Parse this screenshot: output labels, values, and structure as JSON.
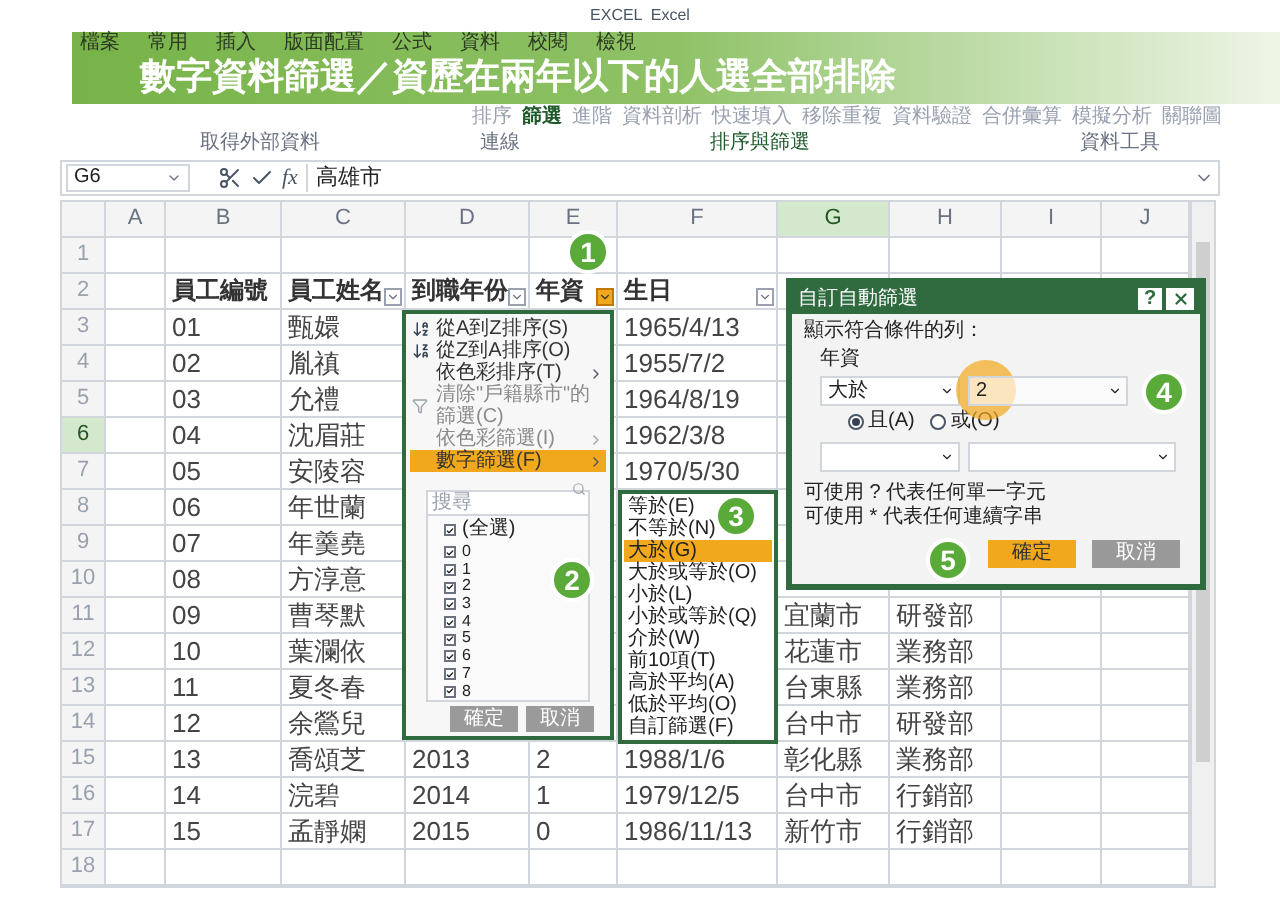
{
  "window": {
    "title": "EXCEL  Excel"
  },
  "banner": {
    "tabs": [
      "檔案",
      "常用",
      "插入",
      "版面配置",
      "公式",
      "資料",
      "校閱",
      "檢視"
    ],
    "title": "數字資料篩選／資歷在兩年以下的人選全部排除"
  },
  "ribbon": {
    "commands": [
      {
        "label": "排序",
        "selected": false
      },
      {
        "label": "篩選",
        "selected": true
      },
      {
        "label": "進階",
        "selected": false
      },
      {
        "label": "資料剖析",
        "selected": false
      },
      {
        "label": "快速填入",
        "selected": false
      },
      {
        "label": "移除重複",
        "selected": false
      },
      {
        "label": "資料驗證",
        "selected": false
      },
      {
        "label": "合併彙算",
        "selected": false
      },
      {
        "label": "模擬分析",
        "selected": false
      },
      {
        "label": "關聯圖",
        "selected": false
      }
    ],
    "groups": [
      "取得外部資料",
      "連線",
      "排序與篩選",
      "資料工具"
    ]
  },
  "formula_bar": {
    "name_box": "G6",
    "function_label": "fx",
    "formula": "高雄市"
  },
  "sheet": {
    "columns": [
      {
        "label": "A",
        "selected": false
      },
      {
        "label": "B",
        "selected": false
      },
      {
        "label": "C",
        "selected": false,
        "filter_button": {
          "active": false
        }
      },
      {
        "label": "D",
        "selected": false,
        "filter_button": {
          "active": false
        }
      },
      {
        "label": "E",
        "selected": false,
        "filter_button": {
          "active": true
        }
      },
      {
        "label": "F",
        "selected": false,
        "filter_button": {
          "active": false
        }
      },
      {
        "label": "G",
        "selected": true
      },
      {
        "label": "H",
        "selected": false
      },
      {
        "label": "I",
        "selected": false
      },
      {
        "label": "J",
        "selected": false
      }
    ],
    "rows": [
      {
        "number": "1",
        "selected": false,
        "cells": [
          null,
          null,
          null,
          null,
          null,
          null,
          null,
          null,
          null,
          null
        ]
      },
      {
        "number": "2",
        "selected": false,
        "kind": "header",
        "cells": [
          null,
          "員工編號",
          "員工姓名",
          "到職年份",
          "年資",
          "生日",
          null,
          null,
          null,
          null
        ]
      },
      {
        "number": "3",
        "selected": false,
        "cells": [
          null,
          "01",
          "甄嬛",
          null,
          null,
          "1965/4/13",
          null,
          null,
          null,
          null
        ]
      },
      {
        "number": "4",
        "selected": false,
        "cells": [
          null,
          "02",
          "胤禛",
          null,
          null,
          "1955/7/2",
          null,
          null,
          null,
          null
        ]
      },
      {
        "number": "5",
        "selected": false,
        "cells": [
          null,
          "03",
          "允禮",
          null,
          null,
          "1964/8/19",
          null,
          null,
          null,
          null
        ]
      },
      {
        "number": "6",
        "selected": true,
        "cells": [
          null,
          "04",
          "沈眉莊",
          null,
          null,
          "1962/3/8",
          null,
          null,
          null,
          null
        ]
      },
      {
        "number": "7",
        "selected": false,
        "cells": [
          null,
          "05",
          "安陵容",
          null,
          null,
          "1970/5/30",
          null,
          null,
          null,
          null
        ]
      },
      {
        "number": "8",
        "selected": false,
        "cells": [
          null,
          "06",
          "年世蘭",
          null,
          null,
          null,
          null,
          null,
          null,
          null
        ]
      },
      {
        "number": "9",
        "selected": false,
        "cells": [
          null,
          "07",
          "年羹堯",
          null,
          null,
          null,
          null,
          null,
          null,
          null
        ]
      },
      {
        "number": "10",
        "selected": false,
        "cells": [
          null,
          "08",
          "方淳意",
          null,
          null,
          null,
          null,
          null,
          null,
          null
        ]
      },
      {
        "number": "11",
        "selected": false,
        "cells": [
          null,
          "09",
          "曹琴默",
          null,
          null,
          null,
          "宜蘭市",
          "研發部",
          null,
          null
        ]
      },
      {
        "number": "12",
        "selected": false,
        "cells": [
          null,
          "10",
          "葉瀾依",
          null,
          null,
          null,
          "花蓮市",
          "業務部",
          null,
          null
        ]
      },
      {
        "number": "13",
        "selected": false,
        "cells": [
          null,
          "11",
          "夏冬春",
          null,
          null,
          null,
          "台東縣",
          "業務部",
          null,
          null
        ]
      },
      {
        "number": "14",
        "selected": false,
        "cells": [
          null,
          "12",
          "余鶯兒",
          null,
          null,
          null,
          "台中市",
          "研發部",
          null,
          null
        ]
      },
      {
        "number": "15",
        "selected": false,
        "cells": [
          null,
          "13",
          "喬頌芝",
          "2013",
          "2",
          "1988/1/6",
          "彰化縣",
          "業務部",
          null,
          null
        ]
      },
      {
        "number": "16",
        "selected": false,
        "cells": [
          null,
          "14",
          "浣碧",
          "2014",
          "1",
          "1979/12/5",
          "台中市",
          "行銷部",
          null,
          null
        ]
      },
      {
        "number": "17",
        "selected": false,
        "cells": [
          null,
          "15",
          "孟靜嫻",
          "2015",
          "0",
          "1986/11/13",
          "新竹市",
          "行銷部",
          null,
          null
        ]
      },
      {
        "number": "18",
        "selected": false,
        "cells": [
          null,
          null,
          null,
          null,
          null,
          null,
          null,
          null,
          null,
          null
        ]
      }
    ]
  },
  "filter_menu": {
    "items": [
      {
        "label": "從A到Z排序(S)",
        "kind": "sort_ascending",
        "submenu": false,
        "disabled": false,
        "selected": false
      },
      {
        "label": "從Z到A排序(O)",
        "kind": "sort_descending",
        "submenu": false,
        "disabled": false,
        "selected": false
      },
      {
        "label": "依色彩排序(T)",
        "kind": "command",
        "submenu": true,
        "disabled": false,
        "selected": false
      },
      {
        "label": "清除\"戶籍縣市\"的篩選(C)",
        "kind": "clear_filter",
        "submenu": false,
        "disabled": true,
        "selected": false
      },
      {
        "label": "依色彩篩選(I)",
        "kind": "command",
        "submenu": true,
        "disabled": true,
        "selected": false
      },
      {
        "label": "數字篩選(F)",
        "kind": "command",
        "submenu": true,
        "disabled": false,
        "selected": true
      }
    ],
    "search": {
      "placeholder": "搜尋"
    },
    "values": [
      {
        "label": "(全選)",
        "checked": true
      },
      {
        "label": "0",
        "checked": true
      },
      {
        "label": "1",
        "checked": true
      },
      {
        "label": "2",
        "checked": true
      },
      {
        "label": "3",
        "checked": true
      },
      {
        "label": "4",
        "checked": true
      },
      {
        "label": "5",
        "checked": true
      },
      {
        "label": "6",
        "checked": true
      },
      {
        "label": "7",
        "checked": true
      },
      {
        "label": "8",
        "checked": true
      }
    ],
    "buttons": [
      "確定",
      "取消"
    ]
  },
  "submenu": {
    "items": [
      {
        "label": "等於(E)",
        "selected": false
      },
      {
        "label": "不等於(N)",
        "selected": false
      },
      {
        "label": "大於(G)",
        "selected": true
      },
      {
        "label": "大於或等於(O)",
        "selected": false
      },
      {
        "label": "小於(L)",
        "selected": false
      },
      {
        "label": "小於或等於(Q)",
        "selected": false
      },
      {
        "label": "介於(W)",
        "selected": false
      },
      {
        "label": "前10項(T)",
        "selected": false
      },
      {
        "label": "高於平均(A)",
        "selected": false
      },
      {
        "label": "低於平均(O)",
        "selected": false
      },
      {
        "label": "自訂篩選(F)",
        "selected": false
      }
    ]
  },
  "dialog": {
    "title": "自訂自動篩選",
    "help": "?",
    "prompt": "顯示符合條件的列：",
    "field": "年資",
    "operator": "大於",
    "value": "2",
    "logic": [
      {
        "label": "且(A)",
        "selected": true
      },
      {
        "label": "或(O)",
        "selected": false
      }
    ],
    "hints": [
      "可使用 ? 代表任何單一字元",
      "可使用 * 代表任何連續字串"
    ],
    "buttons": [
      {
        "label": "確定",
        "primary": true
      },
      {
        "label": "取消",
        "primary": false
      }
    ]
  },
  "steps": [
    "1",
    "2",
    "3",
    "4",
    "5"
  ]
}
